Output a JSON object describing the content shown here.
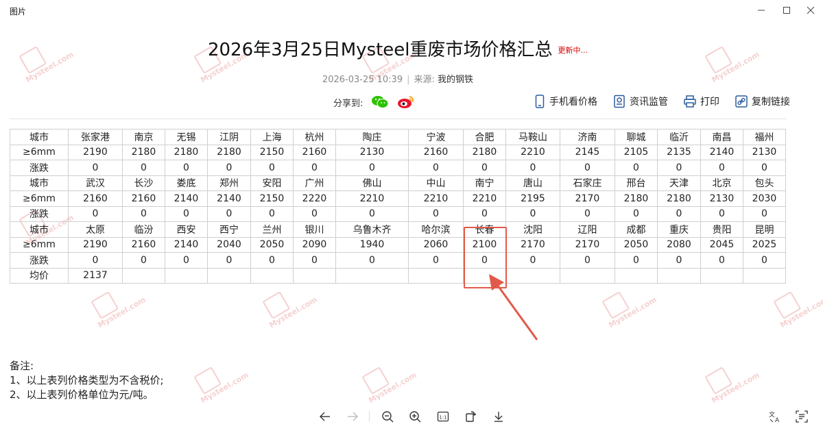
{
  "window": {
    "title": "图片"
  },
  "article": {
    "title": "2026年3月25日Mysteel重废市场价格汇总",
    "update_tag": "更新中...",
    "datetime": "2026-03-25 10:39",
    "separator": "|",
    "source_label": "来源:",
    "source_name": "我的钢铁",
    "share_label": "分享到:"
  },
  "toolbar": {
    "mobile": "手机看价格",
    "monitor": "资讯监管",
    "print": "打印",
    "copy_link": "复制链接"
  },
  "table": {
    "blocks": [
      {
        "city_label": "城市",
        "price_label": "≥6mm",
        "change_label": "涨跌",
        "cities": [
          "张家港",
          "南京",
          "无锡",
          "江阴",
          "上海",
          "杭州",
          "陶庄",
          "宁波",
          "合肥",
          "马鞍山",
          "济南",
          "聊城",
          "临沂",
          "南昌",
          "福州"
        ],
        "prices": [
          "2190",
          "2180",
          "2180",
          "2180",
          "2150",
          "2160",
          "2130",
          "2160",
          "2180",
          "2210",
          "2145",
          "2105",
          "2135",
          "2140",
          "2130"
        ],
        "changes": [
          "0",
          "0",
          "0",
          "0",
          "0",
          "0",
          "0",
          "0",
          "0",
          "0",
          "0",
          "0",
          "0",
          "0",
          "0"
        ]
      },
      {
        "city_label": "城市",
        "price_label": "≥6mm",
        "change_label": "涨跌",
        "cities": [
          "武汉",
          "长沙",
          "娄底",
          "郑州",
          "安阳",
          "广州",
          "佛山",
          "中山",
          "南宁",
          "唐山",
          "石家庄",
          "邢台",
          "天津",
          "北京",
          "包头"
        ],
        "prices": [
          "2160",
          "2160",
          "2140",
          "2140",
          "2150",
          "2220",
          "2210",
          "2210",
          "2210",
          "2195",
          "2170",
          "2180",
          "2180",
          "2130",
          "2030"
        ],
        "changes": [
          "0",
          "0",
          "0",
          "0",
          "0",
          "0",
          "0",
          "0",
          "0",
          "0",
          "0",
          "0",
          "0",
          "0",
          "0"
        ]
      },
      {
        "city_label": "城市",
        "price_label": "≥6mm",
        "change_label": "涨跌",
        "cities": [
          "太原",
          "临汾",
          "西安",
          "西宁",
          "兰州",
          "银川",
          "乌鲁木齐",
          "哈尔滨",
          "长春",
          "沈阳",
          "辽阳",
          "成都",
          "重庆",
          "贵阳",
          "昆明"
        ],
        "prices": [
          "2190",
          "2160",
          "2140",
          "2040",
          "2050",
          "2090",
          "1940",
          "2060",
          "2100",
          "2170",
          "2170",
          "2050",
          "2080",
          "2045",
          "2025"
        ],
        "changes": [
          "0",
          "0",
          "0",
          "0",
          "0",
          "0",
          "0",
          "0",
          "0",
          "0",
          "0",
          "0",
          "0",
          "0",
          "0"
        ]
      }
    ],
    "avg_label": "均价",
    "avg_value": "2137"
  },
  "notes": {
    "heading": "备注:",
    "line1": "1、以上表列价格类型为不含税价;",
    "line2": "2、以上表列价格单位为元/吨。"
  },
  "watermark": {
    "text": "Mysteel.com"
  },
  "colors": {
    "highlight": "#e05a4a",
    "update_tag": "#d40000",
    "wechat": "#2dc100",
    "weibo": "#e6162d"
  }
}
